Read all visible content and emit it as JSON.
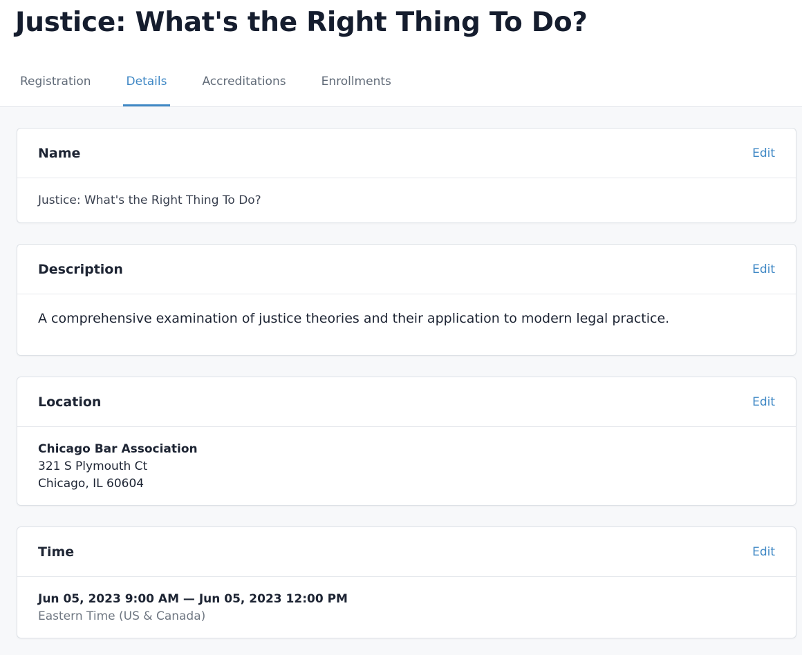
{
  "page": {
    "title": "Justice: What's the Right Thing To Do?"
  },
  "tabs": [
    {
      "label": "Registration",
      "active": false
    },
    {
      "label": "Details",
      "active": true
    },
    {
      "label": "Accreditations",
      "active": false
    },
    {
      "label": "Enrollments",
      "active": false
    }
  ],
  "cards": {
    "name": {
      "title": "Name",
      "edit_label": "Edit",
      "value": "Justice: What's the Right Thing To Do?"
    },
    "description": {
      "title": "Description",
      "edit_label": "Edit",
      "value": "A comprehensive examination of justice theories and their application to modern legal practice."
    },
    "location": {
      "title": "Location",
      "edit_label": "Edit",
      "venue": "Chicago Bar Association",
      "street": "321 S Plymouth Ct",
      "city_line": "Chicago, IL 60604"
    },
    "time": {
      "title": "Time",
      "edit_label": "Edit",
      "range": "Jun 05, 2023 9:00 AM — Jun 05, 2023 12:00 PM",
      "timezone": "Eastern Time (US & Canada)"
    }
  },
  "colors": {
    "accent": "#3f88c5",
    "title": "#151d2e",
    "background": "#f7f8fa"
  }
}
